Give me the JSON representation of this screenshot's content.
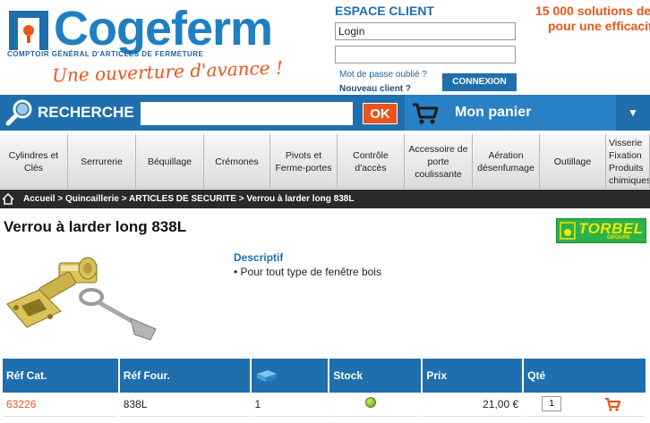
{
  "header": {
    "logo_text": "Cogeferm",
    "logo_subtitle": "COMPTOIR GÉNÉRAL D'ARTICLES DE FERMETURE",
    "logo_slogan": "Une ouverture d'avance !",
    "espace_title": "ESPACE CLIENT",
    "login_value": "Login",
    "password_value": "",
    "forgot_password": "Mot de passe oublié ?",
    "new_client": "Nouveau client ?",
    "connexion_label": "CONNEXION",
    "promo_line1": "15 000 solutions de",
    "promo_line2": "pour une efficacit"
  },
  "search": {
    "label": "RECHERCHE",
    "value": "",
    "ok_label": "OK"
  },
  "cart": {
    "label": "Mon panier",
    "arrow": "▼"
  },
  "nav": {
    "items": [
      {
        "label": "Cylindres et Clés"
      },
      {
        "label": "Serrurerie"
      },
      {
        "label": "Béquillage"
      },
      {
        "label": "Crémones"
      },
      {
        "label": "Pivots et Ferme-portes"
      },
      {
        "label": "Contrôle d'accès"
      },
      {
        "label": "Accessoire de porte coulissante"
      },
      {
        "label": "Aération désenfumage"
      },
      {
        "label": "Outillage"
      },
      {
        "label": "Visserie Fixation Produits chimiques"
      }
    ]
  },
  "breadcrumb": {
    "text": "Accueil > Quincaillerie > ARTICLES DE SECURITE > Verrou à larder long 838L"
  },
  "product": {
    "title": "Verrou à larder long 838L",
    "brand_name": "TORBEL",
    "brand_sub": "GROUPE",
    "desc_title": "Descriptif",
    "desc_line": "• Pour tout type de fenêtre bois"
  },
  "table": {
    "headers": {
      "ref_cat": "Réf Cat.",
      "ref_four": "Réf Four.",
      "stock": "Stock",
      "prix": "Prix",
      "qte": "Qté"
    },
    "rows": [
      {
        "ref_cat": "63226",
        "ref_four": "838L",
        "pack": "1",
        "stock_status": "in-stock",
        "prix": "21,00 €",
        "qte": "1"
      }
    ]
  },
  "colors": {
    "brand_blue": "#1f6fae",
    "accent_orange": "#e8561b",
    "stock_green": "#5aa500"
  }
}
